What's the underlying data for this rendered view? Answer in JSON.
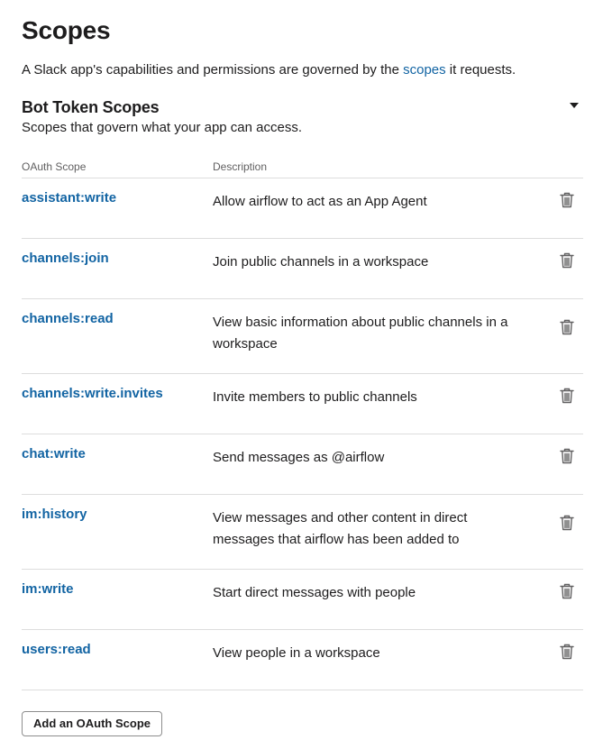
{
  "page": {
    "title": "Scopes",
    "intro_prefix": "A Slack app's capabilities and permissions are governed by the ",
    "intro_link": "scopes",
    "intro_suffix": " it requests."
  },
  "bot_section": {
    "title": "Bot Token Scopes",
    "subtitle": "Scopes that govern what your app can access.",
    "collapse_icon": "caret-down-icon",
    "columns": {
      "scope": "OAuth Scope",
      "description": "Description"
    },
    "row_action_icon": "trash-icon",
    "rows": [
      {
        "scope": "assistant:write",
        "description": "Allow airflow to act as an App Agent"
      },
      {
        "scope": "channels:join",
        "description": "Join public channels in a workspace"
      },
      {
        "scope": "channels:read",
        "description": "View basic information about public channels in a workspace"
      },
      {
        "scope": "channels:write.invites",
        "description": "Invite members to public channels"
      },
      {
        "scope": "chat:write",
        "description": "Send messages as @airflow"
      },
      {
        "scope": "im:history",
        "description": "View messages and other content in direct messages that airflow has been added to"
      },
      {
        "scope": "im:write",
        "description": "Start direct messages with people"
      },
      {
        "scope": "users:read",
        "description": "View people in a workspace"
      }
    ],
    "add_button_label": "Add an OAuth Scope"
  },
  "colors": {
    "link": "#1264a3",
    "text": "#1d1c1d",
    "muted": "#616061",
    "divider": "#dddddd"
  }
}
